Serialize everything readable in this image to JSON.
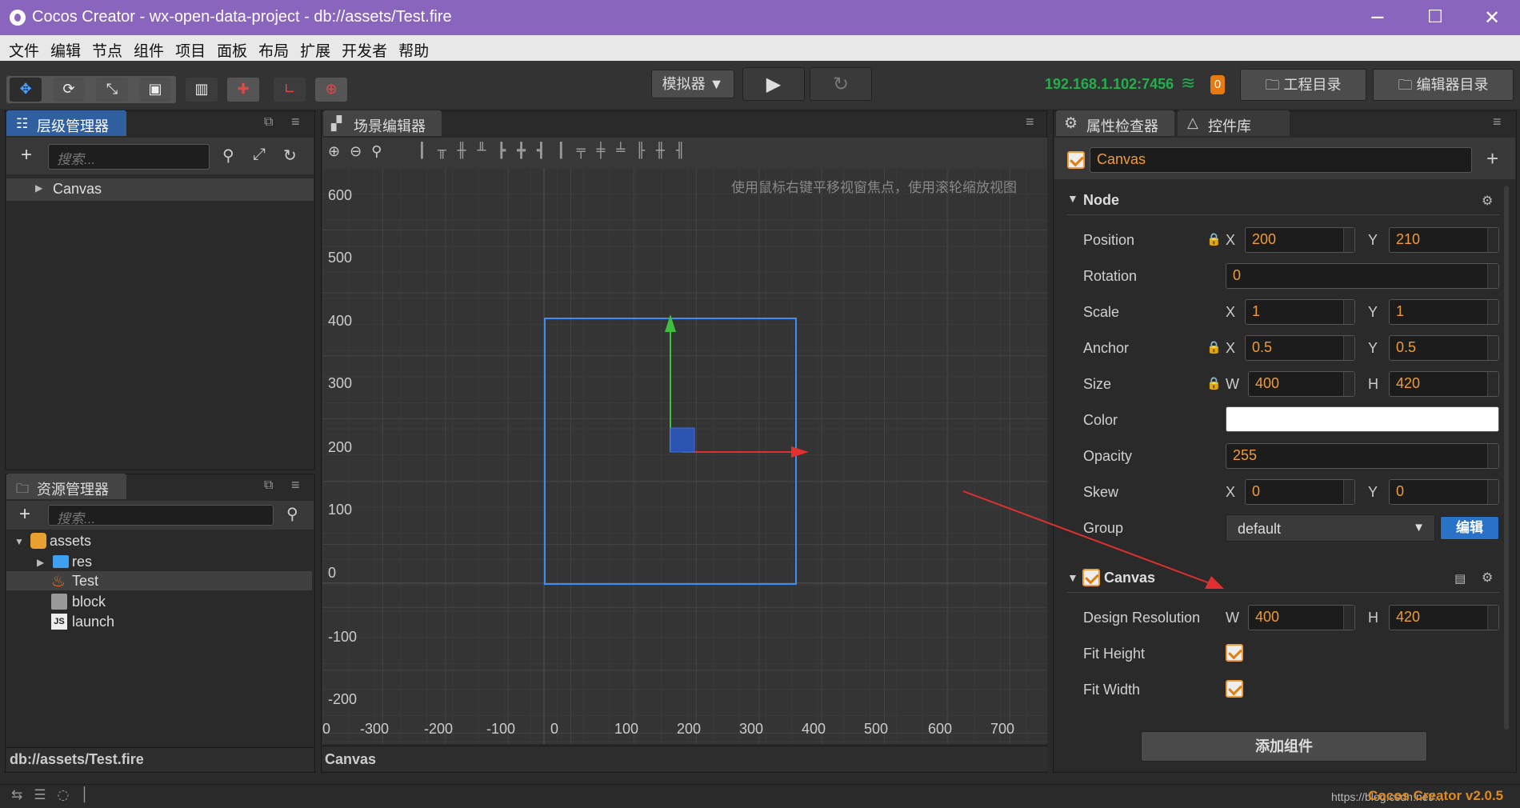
{
  "window": {
    "title": "Cocos Creator - wx-open-data-project - db://assets/Test.fire",
    "minimize": "─",
    "maximize": "☐",
    "close": "✕"
  },
  "menu": [
    "文件",
    "编辑",
    "节点",
    "组件",
    "项目",
    "面板",
    "布局",
    "扩展",
    "开发者",
    "帮助"
  ],
  "toolbar": {
    "simulator": "模拟器 ▼",
    "ip": "192.168.1.102:7456",
    "badge": "0",
    "project_dir": "工程目录",
    "editor_dir": "编辑器目录"
  },
  "hierarchy": {
    "tab": "层级管理器",
    "search_placeholder": "搜索...",
    "items": [
      "Canvas"
    ]
  },
  "assets": {
    "tab": "资源管理器",
    "search_placeholder": "搜索...",
    "items": [
      "assets",
      "res",
      "Test",
      "block",
      "launch"
    ],
    "path": "db://assets/Test.fire"
  },
  "scene": {
    "tab": "场景编辑器",
    "hint": "使用鼠标右键平移视窗焦点，使用滚轮缩放视图",
    "y_ticks": [
      "600",
      "500",
      "400",
      "300",
      "200",
      "100",
      "0",
      "-100",
      "-200"
    ],
    "x_ticks": [
      "0",
      "-300",
      "-200",
      "-100",
      "0",
      "100",
      "200",
      "300",
      "400",
      "500",
      "600",
      "700"
    ],
    "footer": "Canvas"
  },
  "inspector": {
    "tab": "属性检查器",
    "tab2": "控件库",
    "node_name": "Canvas",
    "node_section": "Node",
    "position": {
      "label": "Position",
      "x": "200",
      "y": "210"
    },
    "rotation": {
      "label": "Rotation",
      "value": "0"
    },
    "scale": {
      "label": "Scale",
      "x": "1",
      "y": "1"
    },
    "anchor": {
      "label": "Anchor",
      "x": "0.5",
      "y": "0.5"
    },
    "size": {
      "label": "Size",
      "w": "400",
      "h": "420"
    },
    "color": {
      "label": "Color",
      "value": "#ffffff"
    },
    "opacity": {
      "label": "Opacity",
      "value": "255"
    },
    "skew": {
      "label": "Skew",
      "x": "0",
      "y": "0"
    },
    "group": {
      "label": "Group",
      "value": "default",
      "edit": "编辑"
    },
    "canvas_section": "Canvas",
    "design_resolution": {
      "label": "Design Resolution",
      "w": "400",
      "h": "420"
    },
    "fit_height": {
      "label": "Fit Height",
      "checked": true
    },
    "fit_width": {
      "label": "Fit Width",
      "checked": true
    },
    "add_component": "添加组件",
    "axis_x": "X",
    "axis_y": "Y",
    "axis_w": "W",
    "axis_h": "H"
  },
  "status": {
    "right": "https://blog.csdn.net/...",
    "version": "Cocos Creator v2.0.5"
  },
  "colors": {
    "title_bar": "#8a65be",
    "accent": "#f09a38",
    "ip": "#22b04b",
    "tab_active": "#2f5f9e"
  }
}
